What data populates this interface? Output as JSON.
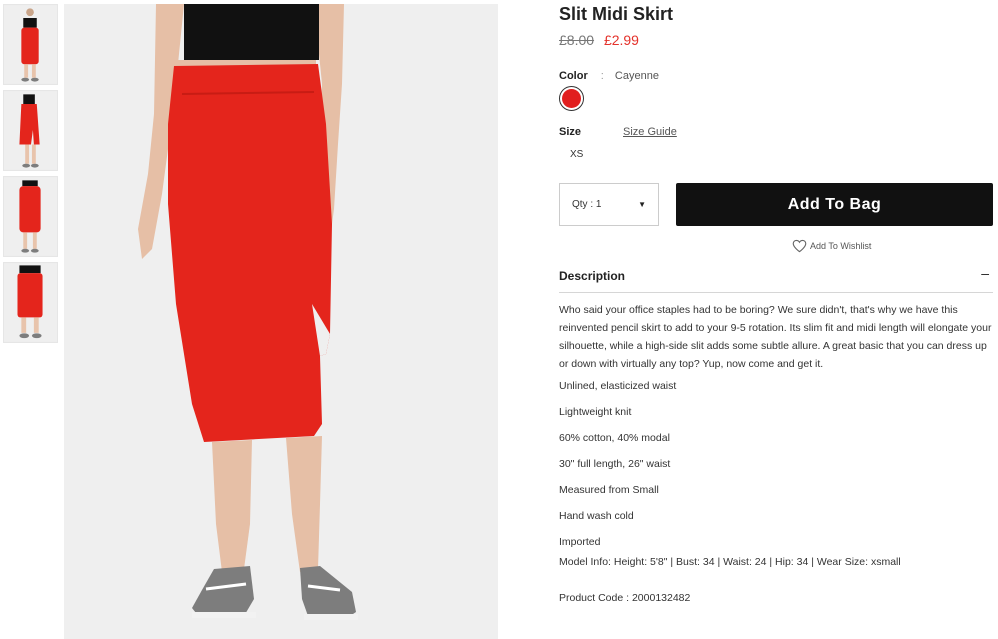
{
  "product": {
    "title": "Slit Midi Skirt",
    "price_original": "£8.00",
    "price_sale": "£2.99"
  },
  "color": {
    "label": "Color",
    "separator": ":",
    "value": "Cayenne",
    "swatch_hex": "#e11f1f"
  },
  "size": {
    "label": "Size",
    "guide_link": "Size Guide",
    "options": [
      "XS"
    ]
  },
  "quantity": {
    "label": "Qty : 1"
  },
  "actions": {
    "add_to_bag": "Add To Bag",
    "add_to_wishlist": "Add To Wishlist"
  },
  "description": {
    "header": "Description",
    "toggle": "–",
    "text": "Who said your office staples had to be boring? We sure didn't, that's why we have this reinvented pencil skirt to add to your 9-5 rotation. Its slim fit and midi length will elongate your silhouette, while a high-side slit adds some subtle allure. A great basic that you can dress up or down with virtually any top? Yup, now come and get it.",
    "features": [
      "Unlined, elasticized waist",
      "Lightweight knit",
      "60% cotton, 40% modal",
      "30\" full length, 26\" waist",
      "Measured from Small",
      "Hand wash cold",
      "Imported"
    ],
    "model_info": "Model Info: Height: 5'8\" | Bust: 34 | Waist: 24 | Hip: 34 | Wear Size: xsmall",
    "product_code": "Product Code : 2000132482"
  },
  "colors": {
    "skirt": "#e4251c",
    "top": "#111111",
    "skin": "#e8c4ac",
    "shoe": "#7d7d7d",
    "background": "#efefef"
  }
}
